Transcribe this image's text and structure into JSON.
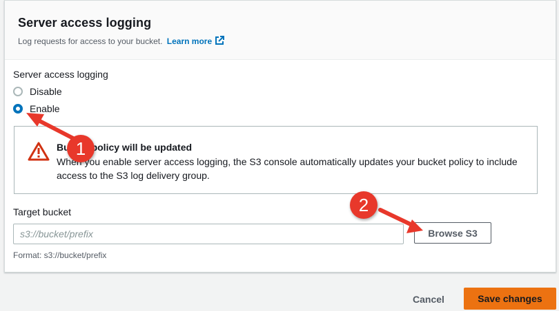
{
  "header": {
    "title": "Server access logging",
    "description": "Log requests for access to your bucket.",
    "learn_more": "Learn more"
  },
  "logging": {
    "label": "Server access logging",
    "options": [
      {
        "label": "Disable",
        "selected": false
      },
      {
        "label": "Enable",
        "selected": true
      }
    ]
  },
  "alert": {
    "title": "Bucket policy will be updated",
    "body": "When you enable server access logging, the S3 console automatically updates your bucket policy to include access to the S3 log delivery group."
  },
  "target": {
    "label": "Target bucket",
    "placeholder": "s3://bucket/prefix",
    "value": "",
    "browse_label": "Browse S3",
    "format_hint": "Format: s3://bucket/prefix"
  },
  "footer": {
    "cancel_label": "Cancel",
    "save_label": "Save changes"
  },
  "annotations": {
    "marker1": "1",
    "marker2": "2"
  },
  "colors": {
    "link": "#0073bb",
    "primary_button": "#ec7211",
    "warning": "#d13212",
    "annotation": "#e8382b"
  }
}
